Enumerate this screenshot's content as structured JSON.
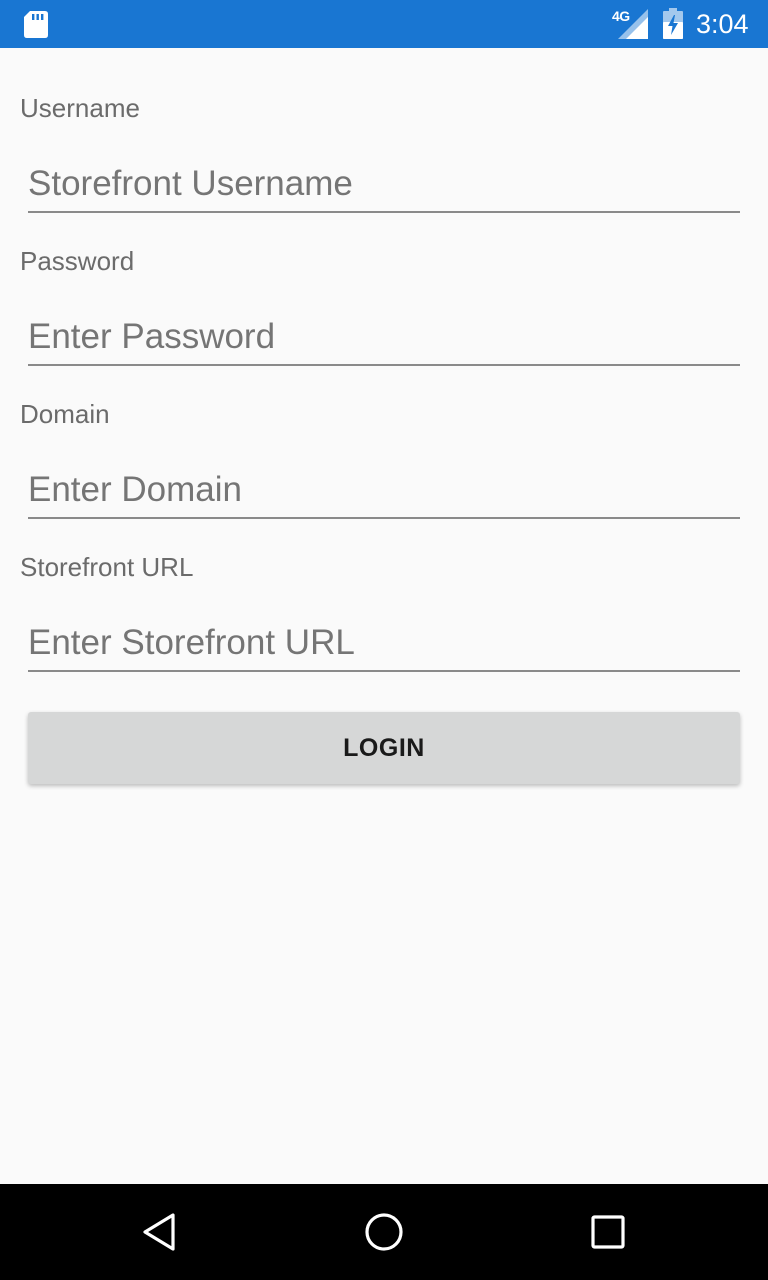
{
  "status_bar": {
    "time": "3:04",
    "network": "4G",
    "background_color": "#1976d2",
    "icons": [
      "sd-card-icon",
      "cell-signal-icon",
      "battery-charging-icon"
    ]
  },
  "form": {
    "username": {
      "label": "Username",
      "placeholder": "Storefront Username",
      "value": ""
    },
    "password": {
      "label": "Password",
      "placeholder": "Enter Password",
      "value": ""
    },
    "domain": {
      "label": "Domain",
      "placeholder": "Enter Domain",
      "value": ""
    },
    "storefront_url": {
      "label": "Storefront URL",
      "placeholder": "Enter Storefront URL",
      "value": ""
    },
    "login_label": "LOGIN"
  },
  "nav_bar": {
    "icons": [
      "back-triangle-icon",
      "home-circle-icon",
      "recents-square-icon"
    ]
  }
}
